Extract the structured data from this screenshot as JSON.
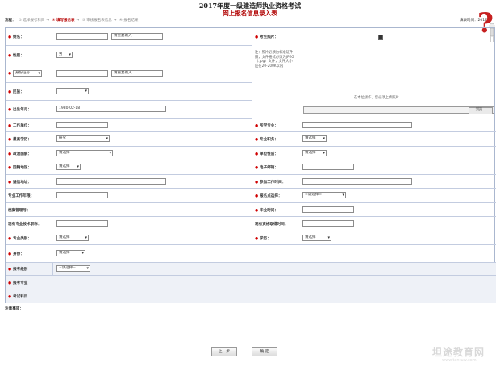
{
  "header": {
    "title": "2017年度一级建造师执业资格考试",
    "subtitle": "网上报名信息录入表",
    "fill_time": "填表时间：2017/"
  },
  "steps": {
    "label": "流程：",
    "items": [
      "① 选择报考科目",
      "② 填写报名表",
      "③ 审核报名表信息",
      "④ 报名结果"
    ],
    "current_index": 1
  },
  "form": {
    "name": {
      "label": "姓名：",
      "confirm_placeholder": "请重复输入"
    },
    "gender": {
      "label": "性别：",
      "value": "男"
    },
    "id_type": {
      "value": "身份证号",
      "confirm_placeholder": "请重复输入"
    },
    "nation": {
      "label": "民族：",
      "value": ""
    },
    "birth": {
      "label": "出生年月：",
      "value": "1980-02-18"
    },
    "photo": {
      "label": "考生照片：",
      "note": "注：照片必须为标准证件照，文件格式必须为JPEG（.jpg）文件，文件大小应在20-200K以内",
      "upload_text": "在本位操作，您必须上传照片",
      "browse_label": "浏览..."
    },
    "workplace": {
      "label": "工作单位："
    },
    "major": {
      "label": "所学专业："
    },
    "education": {
      "label": "最高学历：",
      "value": "研究"
    },
    "title": {
      "label": "专业职务：",
      "value": "请选择"
    },
    "political": {
      "label": "政治面貌：",
      "value": "请选择"
    },
    "unit_nature": {
      "label": "单位性质：",
      "value": "请选择"
    },
    "region": {
      "label": "国籍地区：",
      "value": "请选择"
    },
    "email": {
      "label": "电子邮箱："
    },
    "address": {
      "label": "通信地址："
    },
    "work_start": {
      "label": "参加工作时间："
    },
    "work_years": {
      "label": "专业工作年限："
    },
    "exam_site": {
      "label": "报名点选择：",
      "value": "=请选择="
    },
    "archive": {
      "label": "档案管理号："
    },
    "grad_time": {
      "label": "毕业时间："
    },
    "existing_title": {
      "label": "现有专业技术职称："
    },
    "existing_cert_time": {
      "label": "现有资格取得时间："
    },
    "major_category": {
      "label": "专业类别：",
      "value": "请选择"
    },
    "degree": {
      "label": "学历：",
      "value": "请选择"
    },
    "exam_level": {
      "label": "身份：",
      "value": "请选择"
    },
    "exam_category": {
      "label": "报考级别",
      "value": "=请选择="
    },
    "exam_major": {
      "label": "报考专业"
    },
    "exam_subjects": {
      "label": "考试科目"
    }
  },
  "notes_label": "注意事项：",
  "buttons": {
    "prev": "上一步",
    "confirm": "确 定"
  },
  "watermark": {
    "brand": "坦途教育网",
    "url": "www.tantuw.com"
  }
}
